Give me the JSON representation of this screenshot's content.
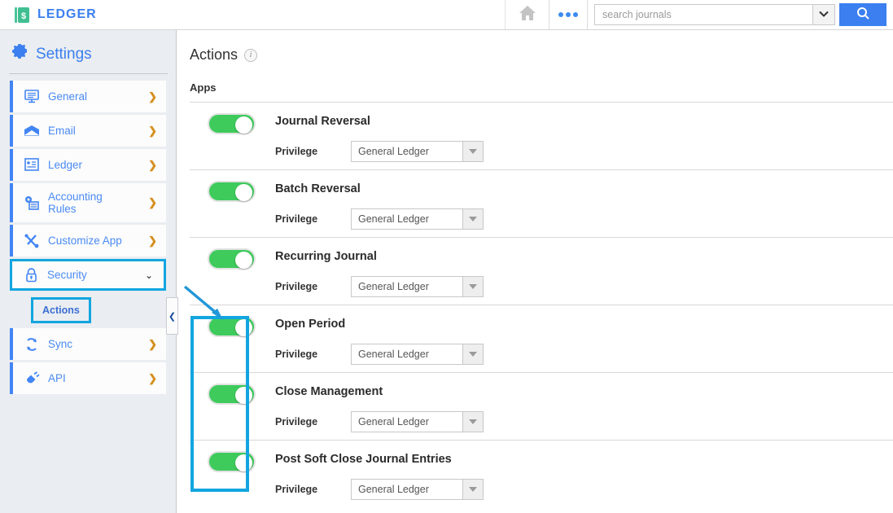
{
  "header": {
    "brand": "LEDGER",
    "brand_color": "#3b7ff0",
    "home_icon": "home-icon",
    "more_icon": "more-dots-icon",
    "search_placeholder": "search journals",
    "search_value": "",
    "search_dropdown_icon": "chevron-down-icon",
    "search_button_icon": "search-icon"
  },
  "sidebar": {
    "title": "Settings",
    "gear_icon": "gear-icon",
    "items": [
      {
        "label": "General",
        "icon": "monitor-icon",
        "chevron": "❯",
        "selected": false
      },
      {
        "label": "Email",
        "icon": "envelope-icon",
        "chevron": "❯",
        "selected": false
      },
      {
        "label": "Ledger",
        "icon": "document-icon",
        "chevron": "❯",
        "selected": false
      },
      {
        "label": "Accounting Rules",
        "icon": "gear-doc-icon",
        "chevron": "❯",
        "selected": false
      },
      {
        "label": "Customize App",
        "icon": "tools-icon",
        "chevron": "❯",
        "selected": false
      },
      {
        "label": "Security",
        "icon": "lock-icon",
        "chevron": "⌄",
        "selected": true
      },
      {
        "label": "Sync",
        "icon": "refresh-icon",
        "chevron": "❯",
        "selected": false
      },
      {
        "label": "API",
        "icon": "plug-icon",
        "chevron": "❯",
        "selected": false
      }
    ],
    "sub_item": {
      "label": "Actions",
      "highlighted": true
    },
    "collapse_icon": "chevron-left-icon"
  },
  "main": {
    "page_title": "Actions",
    "info_icon": "info-icon",
    "section_label": "Apps",
    "privilege_label": "Privilege",
    "rows": [
      {
        "title": "Journal Reversal",
        "enabled": true,
        "privilege": "General Ledger",
        "highlighted": false
      },
      {
        "title": "Batch Reversal",
        "enabled": true,
        "privilege": "General Ledger",
        "highlighted": false
      },
      {
        "title": "Recurring Journal",
        "enabled": true,
        "privilege": "General Ledger",
        "highlighted": false
      },
      {
        "title": "Open Period",
        "enabled": true,
        "privilege": "General Ledger",
        "highlighted": true
      },
      {
        "title": "Close Management",
        "enabled": true,
        "privilege": "General Ledger",
        "highlighted": true
      },
      {
        "title": "Post Soft Close Journal Entries",
        "enabled": true,
        "privilege": "General Ledger",
        "highlighted": true
      }
    ]
  },
  "annotations": {
    "highlight_color": "#12a5e0",
    "arrow_color": "#2196d8",
    "toggle_on_color": "#3ecb5c"
  }
}
